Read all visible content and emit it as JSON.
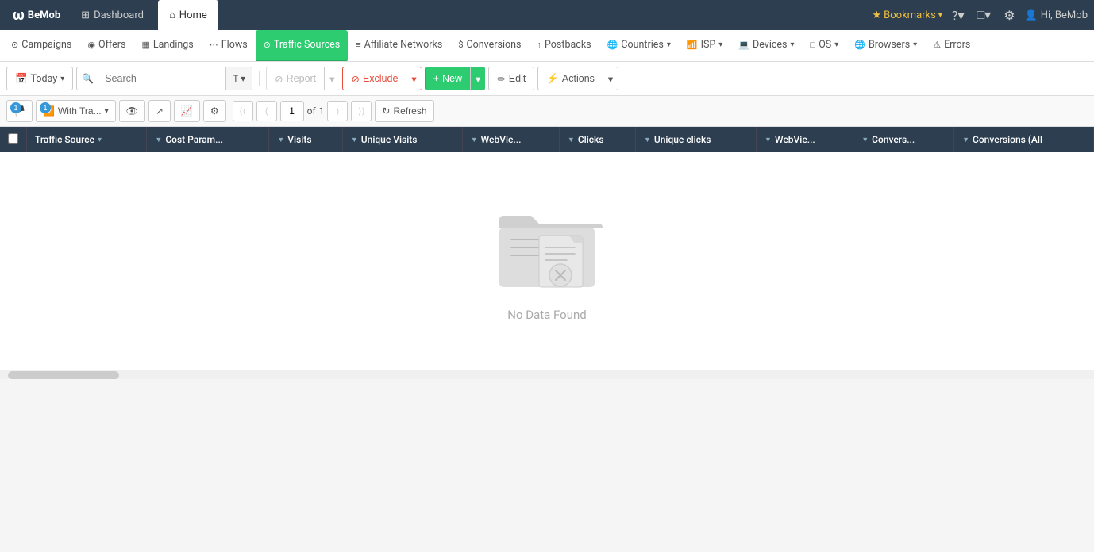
{
  "app": {
    "logo": "BeMob",
    "logo_symbol": "ω"
  },
  "top_nav": {
    "tabs": [
      {
        "id": "dashboard",
        "label": "Dashboard",
        "icon": "⊞",
        "active": false
      },
      {
        "id": "home",
        "label": "Home",
        "icon": "⌂",
        "active": true
      }
    ],
    "right": {
      "bookmarks_label": "Bookmarks",
      "help_icon": "?",
      "notifications_icon": "□",
      "settings_icon": "⚙",
      "user_label": "Hi, BeMob"
    }
  },
  "sec_nav": {
    "items": [
      {
        "id": "campaigns",
        "label": "Campaigns",
        "icon": "⊙",
        "active": false
      },
      {
        "id": "offers",
        "label": "Offers",
        "icon": "◉",
        "active": false
      },
      {
        "id": "landings",
        "label": "Landings",
        "icon": "▦",
        "active": false
      },
      {
        "id": "flows",
        "label": "Flows",
        "icon": "⋯",
        "active": false
      },
      {
        "id": "traffic-sources",
        "label": "Traffic Sources",
        "icon": "⊙",
        "active": true
      },
      {
        "id": "affiliate-networks",
        "label": "Affiliate Networks",
        "icon": "≡",
        "active": false
      },
      {
        "id": "conversions",
        "label": "Conversions",
        "icon": "$",
        "active": false
      },
      {
        "id": "postbacks",
        "label": "Postbacks",
        "icon": "↑",
        "active": false
      },
      {
        "id": "countries",
        "label": "Countries",
        "active": false
      },
      {
        "id": "isp",
        "label": "ISP",
        "active": false
      },
      {
        "id": "devices",
        "label": "Devices",
        "active": false
      },
      {
        "id": "os",
        "label": "OS",
        "active": false
      },
      {
        "id": "browsers",
        "label": "Browsers",
        "active": false
      },
      {
        "id": "errors",
        "label": "Errors",
        "active": false
      }
    ]
  },
  "toolbar": {
    "today_label": "Today",
    "search_placeholder": "Search",
    "report_label": "Report",
    "exclude_label": "Exclude",
    "new_label": "New",
    "edit_label": "Edit",
    "actions_label": "Actions"
  },
  "sub_toolbar": {
    "filter_label": "With Tra...",
    "filter_badge": "1",
    "refresh_label": "Refresh",
    "page_current": "1",
    "page_total": "1"
  },
  "table": {
    "columns": [
      {
        "id": "traffic-source",
        "label": "Traffic Source"
      },
      {
        "id": "cost-param",
        "label": "Cost Param..."
      },
      {
        "id": "visits",
        "label": "Visits"
      },
      {
        "id": "unique-visits",
        "label": "Unique Visits"
      },
      {
        "id": "webview1",
        "label": "WebVie..."
      },
      {
        "id": "clicks",
        "label": "Clicks"
      },
      {
        "id": "unique-clicks",
        "label": "Unique clicks"
      },
      {
        "id": "webview2",
        "label": "WebVie..."
      },
      {
        "id": "conversions",
        "label": "Convers..."
      },
      {
        "id": "conversions-all",
        "label": "Conversions (All"
      }
    ]
  },
  "empty_state": {
    "text": "No Data Found"
  }
}
